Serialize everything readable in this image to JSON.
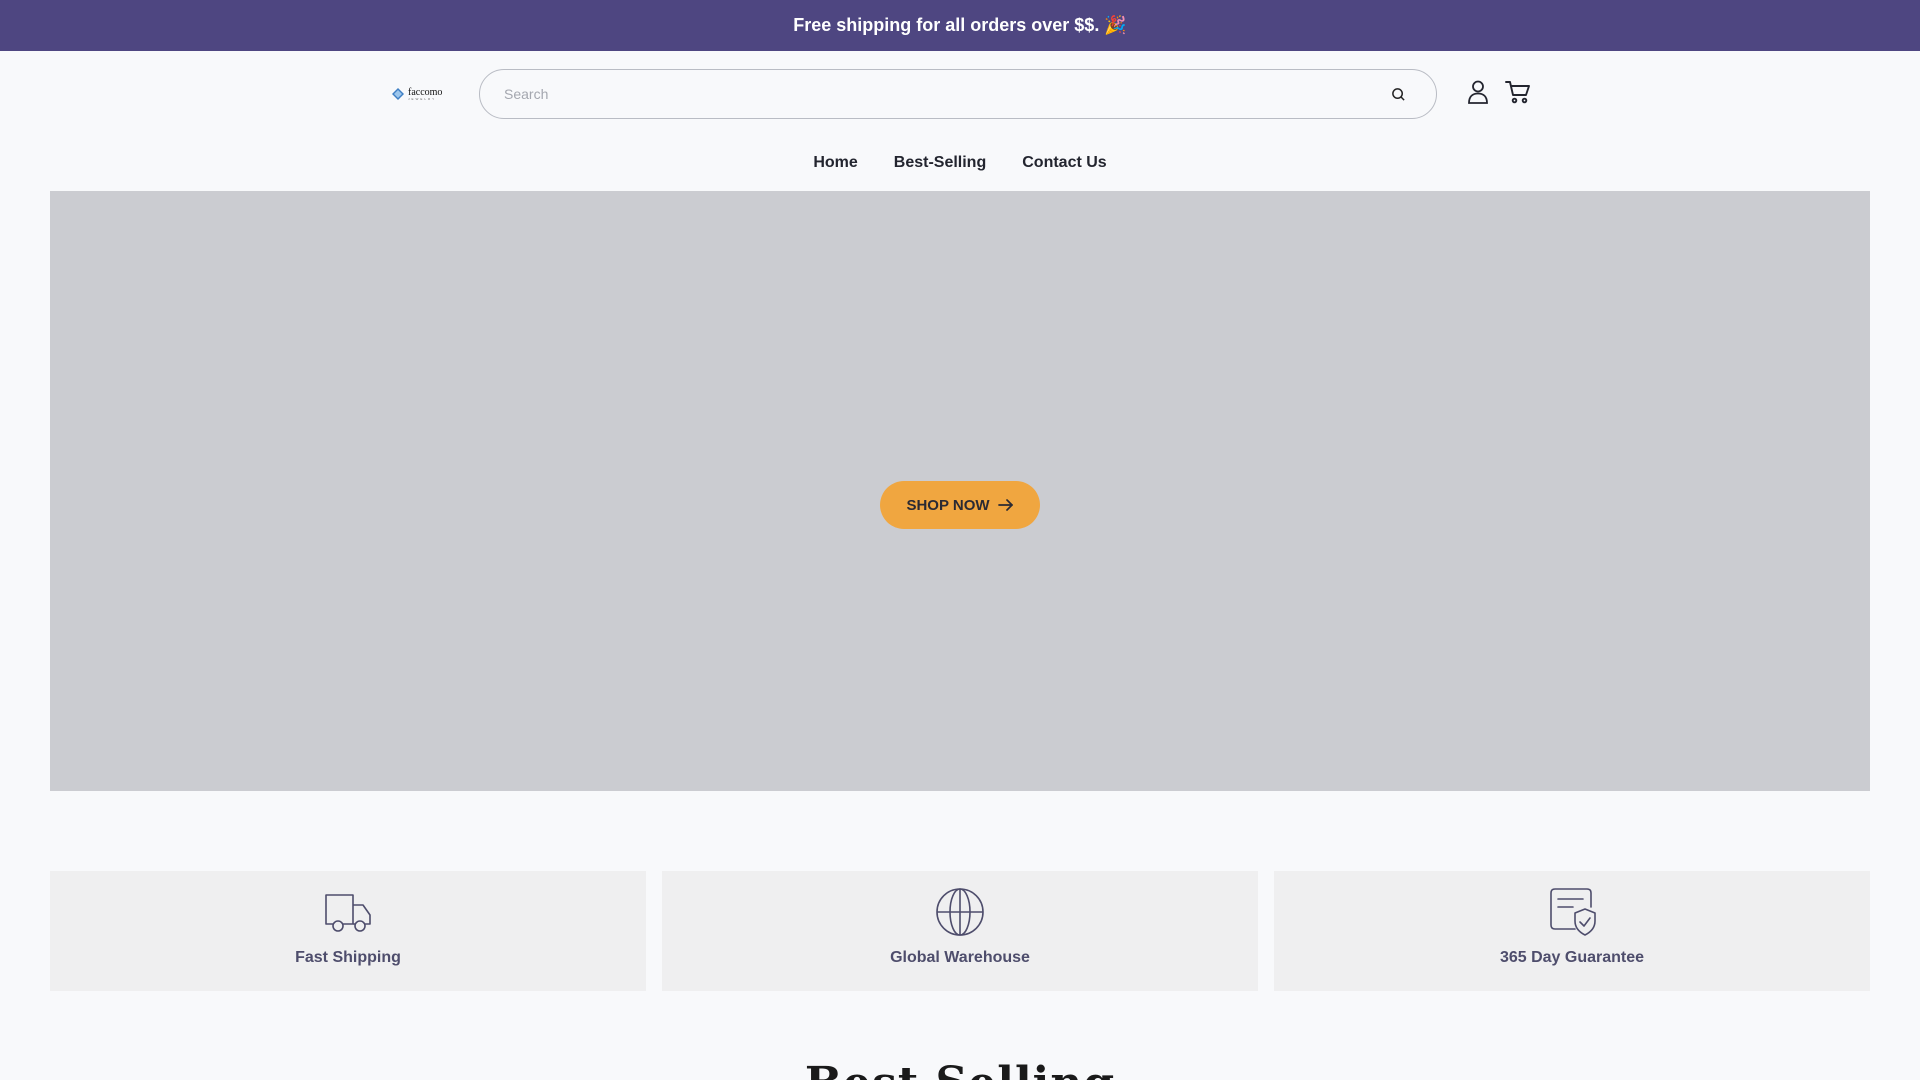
{
  "announcement": {
    "text": "Free shipping for all orders over $$. 🎉"
  },
  "header": {
    "logo": {
      "word": "faccomo",
      "tagline": "JEWELRY",
      "icon": "brand-logo-icon"
    },
    "search": {
      "placeholder": "Search",
      "value": "",
      "icon": "search-icon"
    },
    "account_icon": "user-icon",
    "cart_icon": "cart-icon"
  },
  "nav": {
    "items": [
      {
        "label": "Home"
      },
      {
        "label": "Best-Selling"
      },
      {
        "label": "Contact Us"
      }
    ]
  },
  "hero": {
    "background": "#cbccd1",
    "cta": {
      "label": "SHOP NOW",
      "icon": "arrow-right-icon",
      "color": "#f0a640"
    }
  },
  "features": [
    {
      "label": "Fast Shipping",
      "icon": "truck-icon"
    },
    {
      "label": "Global Warehouse",
      "icon": "globe-icon"
    },
    {
      "label": "365 Day Guarantee",
      "icon": "guarantee-shield-icon"
    }
  ],
  "best_selling": {
    "title": "Best Selling"
  },
  "colors": {
    "accent": "#4e4681",
    "cta": "#f0a640",
    "feature_text": "#4e4d6c"
  }
}
